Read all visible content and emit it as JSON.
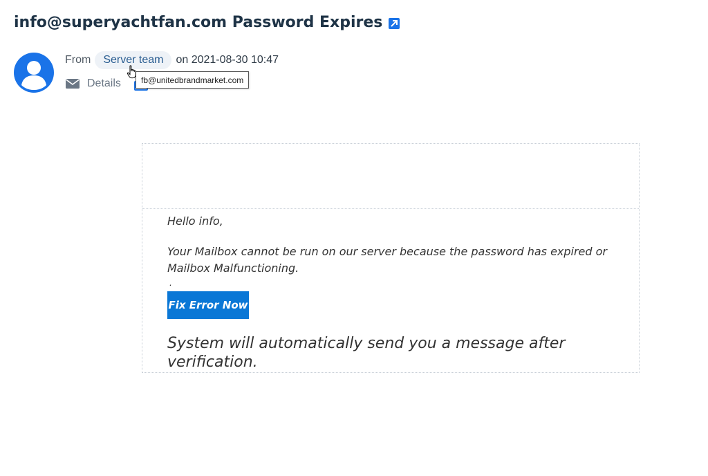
{
  "email": {
    "subject": "info@superyachtfan.com Password Expires",
    "from_label": "From",
    "sender_name": "Server team",
    "date_text": "on 2021-08-30 10:47",
    "details_label": "Details",
    "tooltip_email": "fb@unitedbrandmarket.com"
  },
  "body": {
    "greeting": "Hello info,",
    "message": "Your Mailbox cannot be run on our server because the password has expired or Mailbox Malfunctioning.",
    "separator": ".",
    "button_label": "Fix Error Now",
    "closing": "System will automatically send you a message after verification."
  },
  "colors": {
    "accent": "#1a73e8",
    "button": "#0a77d6",
    "subject_text": "#1e3346"
  },
  "icons": [
    "external-link-icon",
    "user-avatar-icon",
    "envelope-icon",
    "hand-pointer-cursor-icon"
  ]
}
